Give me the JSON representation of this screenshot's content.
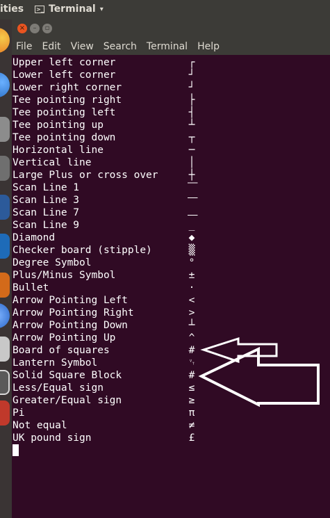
{
  "top_bar": {
    "activities": "ities",
    "app_name": "Terminal",
    "caret": "▾"
  },
  "window": {
    "close": "×",
    "minimize": "–",
    "maximize": "▫"
  },
  "menu": [
    "File",
    "Edit",
    "View",
    "Search",
    "Terminal",
    "Help"
  ],
  "terminal": {
    "rows": [
      {
        "label": "Upper left corner",
        "symbol": "┌",
        "symbol_name": "upper-left-corner-glyph"
      },
      {
        "label": "Lower left corner",
        "symbol": "┘",
        "symbol_name": "lower-left-corner-glyph"
      },
      {
        "label": "Lower right corner",
        "symbol": "┘",
        "symbol_name": "lower-right-corner-glyph"
      },
      {
        "label": "Tee pointing right",
        "symbol": "├",
        "symbol_name": "tee-right-glyph"
      },
      {
        "label": "Tee pointing left",
        "symbol": "┤",
        "symbol_name": "tee-left-glyph"
      },
      {
        "label": "Tee pointing up",
        "symbol": "┴",
        "symbol_name": "tee-up-glyph"
      },
      {
        "label": "Tee pointing down",
        "symbol": "┬",
        "symbol_name": "tee-down-glyph"
      },
      {
        "label": "Horizontal line",
        "symbol": "─",
        "symbol_name": "horizontal-line-glyph"
      },
      {
        "label": "Vertical line",
        "symbol": "│",
        "symbol_name": "vertical-line-glyph"
      },
      {
        "label": "Large Plus or cross over",
        "symbol": "┼",
        "symbol_name": "cross-glyph"
      },
      {
        "label": "Scan Line 1",
        "symbol": "⎺",
        "symbol_name": "scan-line-1-glyph"
      },
      {
        "label": "Scan Line 3",
        "symbol": "⎻",
        "symbol_name": "scan-line-3-glyph"
      },
      {
        "label": "Scan Line 7",
        "symbol": "⎼",
        "symbol_name": "scan-line-7-glyph"
      },
      {
        "label": "Scan Line 9",
        "symbol": "_",
        "symbol_name": "scan-line-9-glyph"
      },
      {
        "label": "Diamond",
        "symbol": "◆",
        "symbol_name": "diamond-glyph"
      },
      {
        "label": "Checker board (stipple)",
        "symbol": "▒",
        "symbol_name": "checker-board-glyph"
      },
      {
        "label": "Degree Symbol",
        "symbol": "°",
        "symbol_name": "degree-glyph"
      },
      {
        "label": "Plus/Minus Symbol",
        "symbol": "±",
        "symbol_name": "plus-minus-glyph"
      },
      {
        "label": "Bullet",
        "symbol": "·",
        "symbol_name": "bullet-glyph"
      },
      {
        "label": "Arrow Pointing Left",
        "symbol": "<",
        "symbol_name": "arrow-left-glyph"
      },
      {
        "label": "Arrow Pointing Right",
        "symbol": ">",
        "symbol_name": "arrow-right-glyph"
      },
      {
        "label": "Arrow Pointing Down",
        "symbol": "┴",
        "symbol_name": "arrow-down-glyph"
      },
      {
        "label": "Arrow Pointing Up",
        "symbol": "^",
        "symbol_name": "arrow-up-glyph"
      },
      {
        "label": "Board of squares",
        "symbol": "#",
        "symbol_name": "board-of-squares-glyph"
      },
      {
        "label": "Lantern Symbol",
        "symbol": "␋",
        "symbol_name": "lantern-glyph"
      },
      {
        "label": "Solid Square Block",
        "symbol": "#",
        "symbol_name": "solid-square-block-glyph"
      },
      {
        "label": "Less/Equal sign",
        "symbol": "≤",
        "symbol_name": "less-equal-glyph"
      },
      {
        "label": "Greater/Equal sign",
        "symbol": "≥",
        "symbol_name": "greater-equal-glyph"
      },
      {
        "label": "Pi",
        "symbol": "π",
        "symbol_name": "pi-glyph"
      },
      {
        "label": "Not equal",
        "symbol": "≠",
        "symbol_name": "not-equal-glyph"
      },
      {
        "label": "UK pound sign",
        "symbol": "£",
        "symbol_name": "pound-glyph"
      }
    ]
  },
  "colors": {
    "terminal_bg": "#300a24",
    "chrome": "#3c3b37",
    "close_button": "#e95420",
    "annotation_arrow": "#ffffff"
  }
}
